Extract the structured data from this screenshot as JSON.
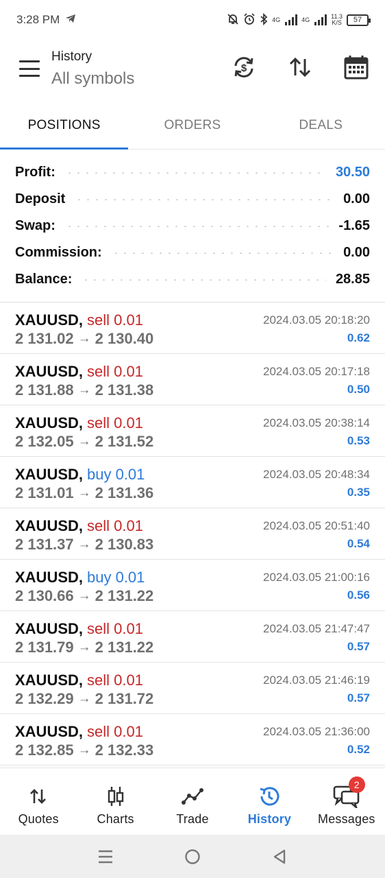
{
  "status_bar": {
    "time": "3:28 PM",
    "net1": "4G",
    "net2": "4G",
    "speed_value": "11.3",
    "speed_unit": "K/S",
    "battery": "57"
  },
  "app_bar": {
    "title": "History",
    "subtitle": "All symbols"
  },
  "tabs": [
    {
      "label": "POSITIONS",
      "active": true
    },
    {
      "label": "ORDERS",
      "active": false
    },
    {
      "label": "DEALS",
      "active": false
    }
  ],
  "summary": {
    "profit": {
      "label": "Profit:",
      "value": "30.50"
    },
    "deposit": {
      "label": "Deposit",
      "value": "0.00"
    },
    "swap": {
      "label": "Swap:",
      "value": "-1.65"
    },
    "commission": {
      "label": "Commission:",
      "value": "0.00"
    },
    "balance": {
      "label": "Balance:",
      "value": "28.85"
    }
  },
  "deals": [
    {
      "symbol": "XAUUSD,",
      "type": "sell 0.01",
      "side": "sell",
      "open_price": "2 131.02",
      "arrow": "→",
      "close_price": "2 130.40",
      "time": "2024.03.05 20:18:20",
      "profit": "0.62"
    },
    {
      "symbol": "XAUUSD,",
      "type": "sell 0.01",
      "side": "sell",
      "open_price": "2 131.88",
      "arrow": "→",
      "close_price": "2 131.38",
      "time": "2024.03.05 20:17:18",
      "profit": "0.50"
    },
    {
      "symbol": "XAUUSD,",
      "type": "sell 0.01",
      "side": "sell",
      "open_price": "2 132.05",
      "arrow": "→",
      "close_price": "2 131.52",
      "time": "2024.03.05 20:38:14",
      "profit": "0.53"
    },
    {
      "symbol": "XAUUSD,",
      "type": "buy 0.01",
      "side": "buy",
      "open_price": "2 131.01",
      "arrow": "→",
      "close_price": "2 131.36",
      "time": "2024.03.05 20:48:34",
      "profit": "0.35"
    },
    {
      "symbol": "XAUUSD,",
      "type": "sell 0.01",
      "side": "sell",
      "open_price": "2 131.37",
      "arrow": "→",
      "close_price": "2 130.83",
      "time": "2024.03.05 20:51:40",
      "profit": "0.54"
    },
    {
      "symbol": "XAUUSD,",
      "type": "buy 0.01",
      "side": "buy",
      "open_price": "2 130.66",
      "arrow": "→",
      "close_price": "2 131.22",
      "time": "2024.03.05 21:00:16",
      "profit": "0.56"
    },
    {
      "symbol": "XAUUSD,",
      "type": "sell 0.01",
      "side": "sell",
      "open_price": "2 131.79",
      "arrow": "→",
      "close_price": "2 131.22",
      "time": "2024.03.05 21:47:47",
      "profit": "0.57"
    },
    {
      "symbol": "XAUUSD,",
      "type": "sell 0.01",
      "side": "sell",
      "open_price": "2 132.29",
      "arrow": "→",
      "close_price": "2 131.72",
      "time": "2024.03.05 21:46:19",
      "profit": "0.57"
    },
    {
      "symbol": "XAUUSD,",
      "type": "sell 0.01",
      "side": "sell",
      "open_price": "2 132.85",
      "arrow": "→",
      "close_price": "2 132.33",
      "time": "2024.03.05 21:36:00",
      "profit": "0.52"
    }
  ],
  "bottom_nav": [
    {
      "label": "Quotes",
      "icon": "quotes-icon",
      "active": false
    },
    {
      "label": "Charts",
      "icon": "charts-icon",
      "active": false
    },
    {
      "label": "Trade",
      "icon": "trade-icon",
      "active": false
    },
    {
      "label": "History",
      "icon": "history-icon",
      "active": true
    },
    {
      "label": "Messages",
      "icon": "messages-icon",
      "active": false,
      "badge": "2"
    }
  ],
  "colors": {
    "accent": "#2d7bd8",
    "sell": "#c62828",
    "buy": "#2d7bd8",
    "badge": "#e53935"
  }
}
